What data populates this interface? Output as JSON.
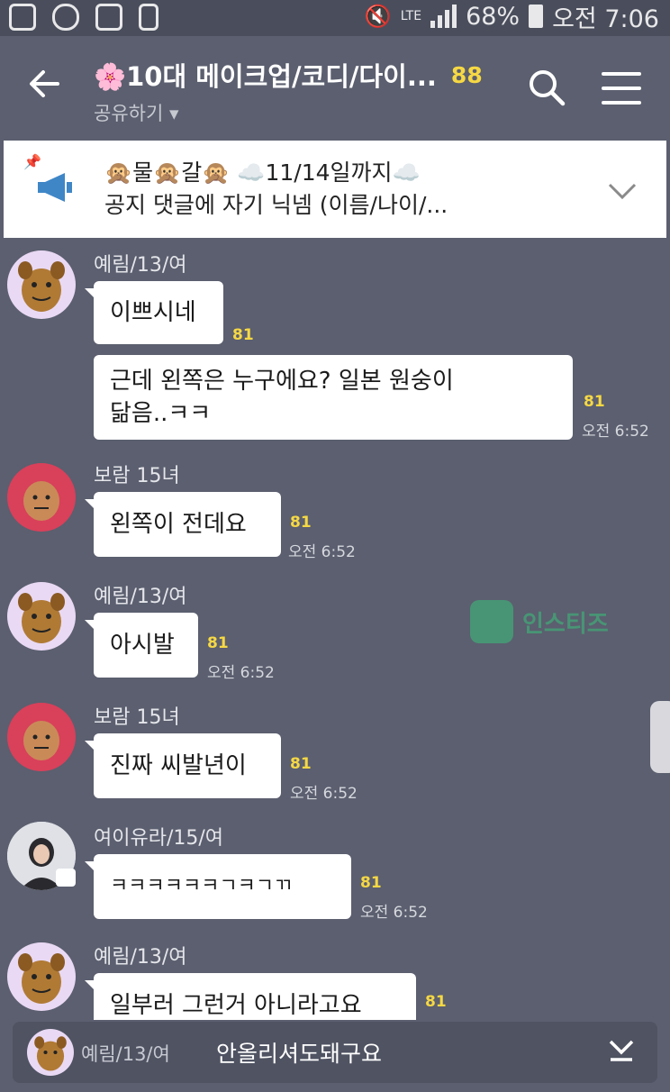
{
  "status_bar": {
    "network": "LTE",
    "battery": "68%",
    "time": "오전 7:06"
  },
  "header": {
    "back_icon": "arrow-left-icon",
    "title": "🌸10대 메이크업/코디/다이...",
    "member_count": "88",
    "subtitle": "공유하기 ▾"
  },
  "notice": {
    "line1": "🙊물🙊갈🙊 ☁️11/14일까지☁️",
    "line2": "공지 댓글에 자기 닉넴 (이름/나이/..."
  },
  "messages": [
    {
      "sender": "예림/13/여",
      "bubbles": [
        "이쁘시네",
        "근데 왼쪽은 누구에요? 일본 원숭이\n닮음..ㅋㅋ"
      ],
      "unread": [
        "81",
        "81"
      ],
      "time": "오전 6:52"
    },
    {
      "sender": "보람 15녀",
      "bubbles": [
        "왼쪽이 전데요"
      ],
      "unread": [
        "81"
      ],
      "time": "오전 6:52"
    },
    {
      "sender": "예림/13/여",
      "bubbles": [
        "아시발"
      ],
      "unread": [
        "81"
      ],
      "time": "오전 6:52"
    },
    {
      "sender": "보람 15녀",
      "bubbles": [
        "진짜 씨발년이"
      ],
      "unread": [
        "81"
      ],
      "time": "오전 6:52"
    },
    {
      "sender": "여이유라/15/여",
      "bubbles": [
        "ㅋㅋㅋㅋㅋㅋㄱㅋㄱㄲ"
      ],
      "unread": [
        "81"
      ],
      "time": "오전 6:52"
    },
    {
      "sender": "예림/13/여",
      "bubbles": [
        "일부러 그런거 아니라고요"
      ],
      "unread": [
        "81"
      ],
      "time": ""
    }
  ],
  "watermark": "인스티즈",
  "preview": {
    "sender": "예림/13/여",
    "text": "안올리셔도돼구요"
  }
}
